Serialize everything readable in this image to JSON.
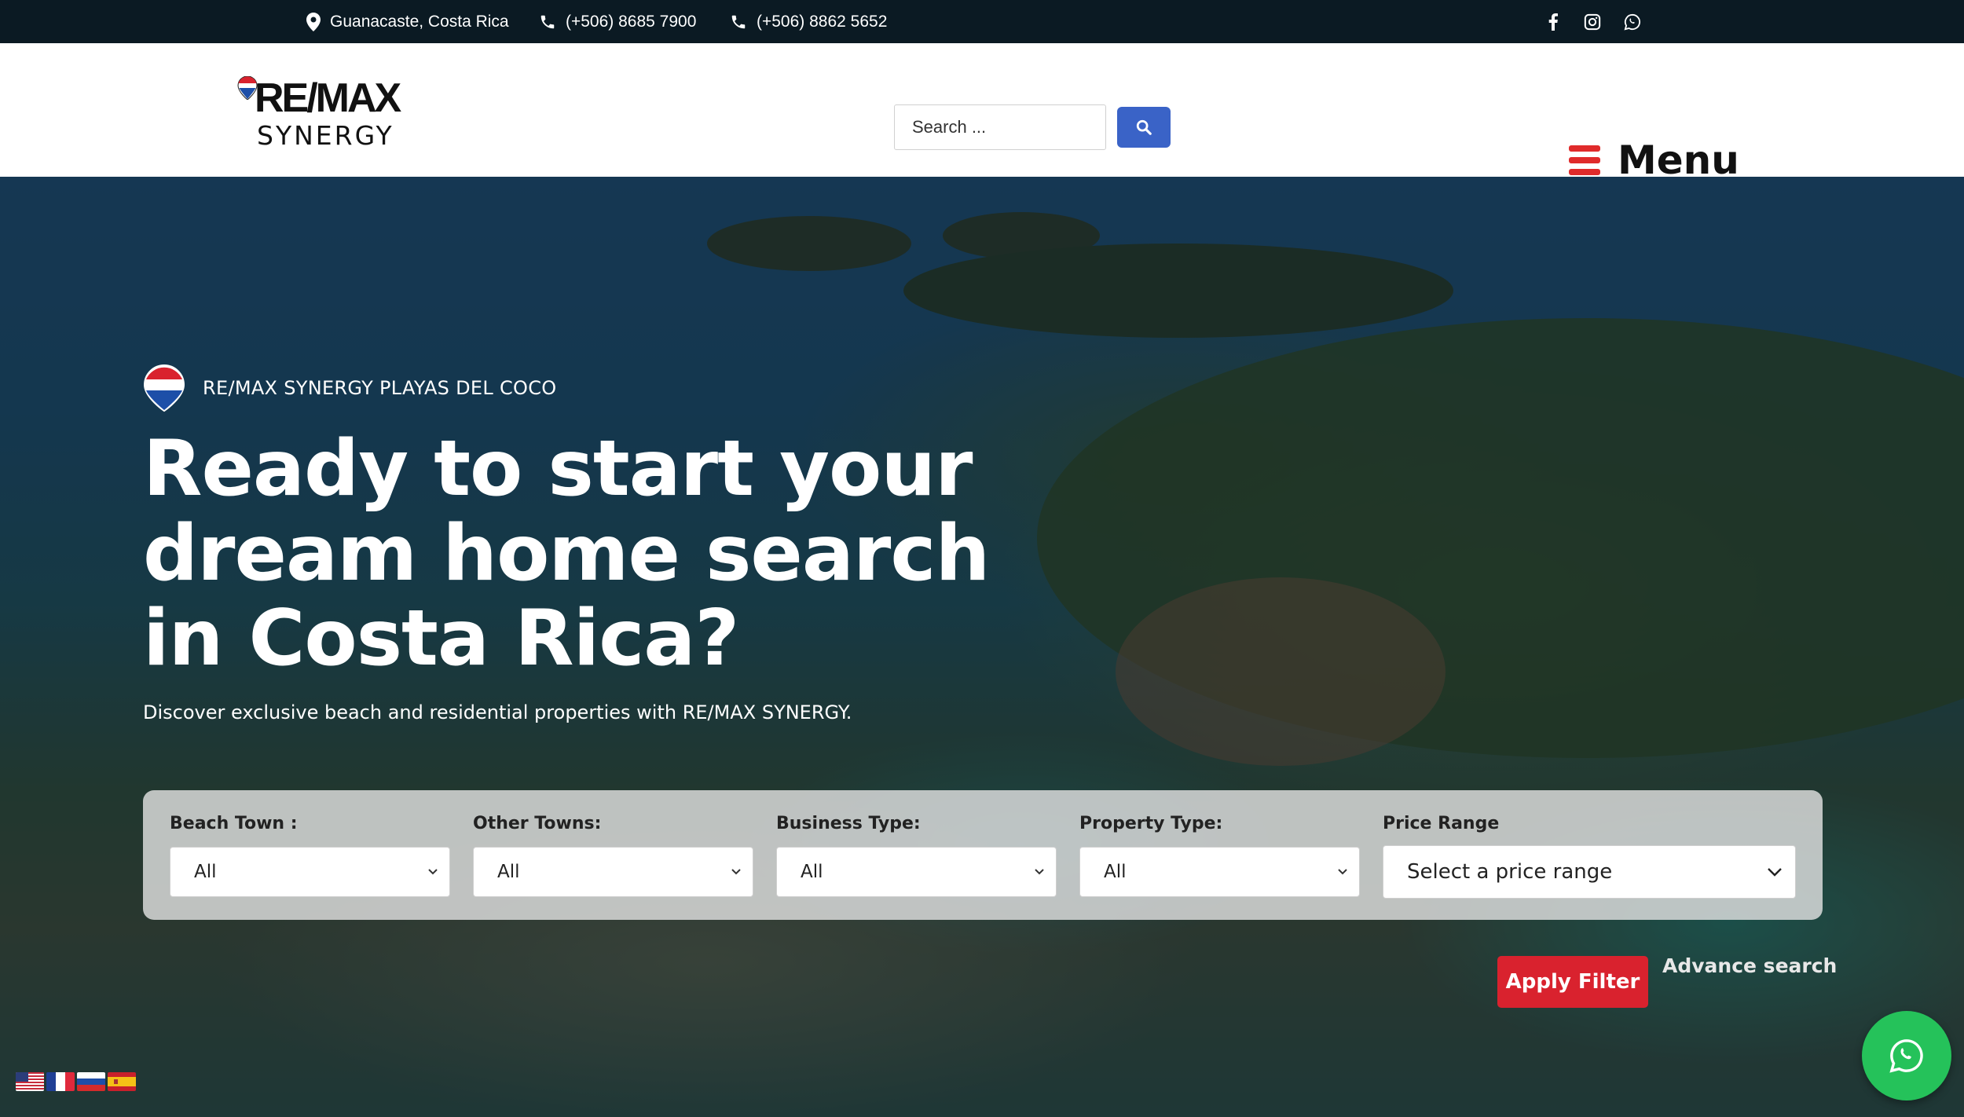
{
  "topbar": {
    "location": "Guanacaste, Costa Rica",
    "phone_1": "(+506) 8685 7900",
    "phone_2": "(+506) 8862 5652",
    "social_icons": [
      "facebook-icon",
      "instagram-icon",
      "whatsapp-icon"
    ]
  },
  "header": {
    "logo_top": "RE/MAX",
    "logo_bottom": "SYNERGY",
    "search_placeholder": "Search ...",
    "menu_label": "Menu"
  },
  "hero": {
    "badge": "RE/MAX SYNERGY PLAYAS DEL COCO",
    "headline_line1": "Ready to start your",
    "headline_line2": "dream home search",
    "headline_line3": "in Costa Rica?",
    "subline": "Discover exclusive beach and residential properties with RE/MAX SYNERGY."
  },
  "filters": [
    {
      "label": "Beach Town :",
      "value": "All"
    },
    {
      "label": "Other Towns:",
      "value": "All"
    },
    {
      "label": "Business Type:",
      "value": "All"
    },
    {
      "label": "Property Type:",
      "value": "All"
    },
    {
      "label": "Price Range",
      "value": "Select a price range"
    }
  ],
  "actions": {
    "apply": "Apply Filter",
    "advanced": "Advance search"
  },
  "languages": [
    "English",
    "Français",
    "Русский",
    "Español"
  ],
  "colors": {
    "topbar": "#0b1a23",
    "accent_red": "#d9222e",
    "search_blue": "#3a63c7",
    "whatsapp_green": "#25c25a"
  }
}
